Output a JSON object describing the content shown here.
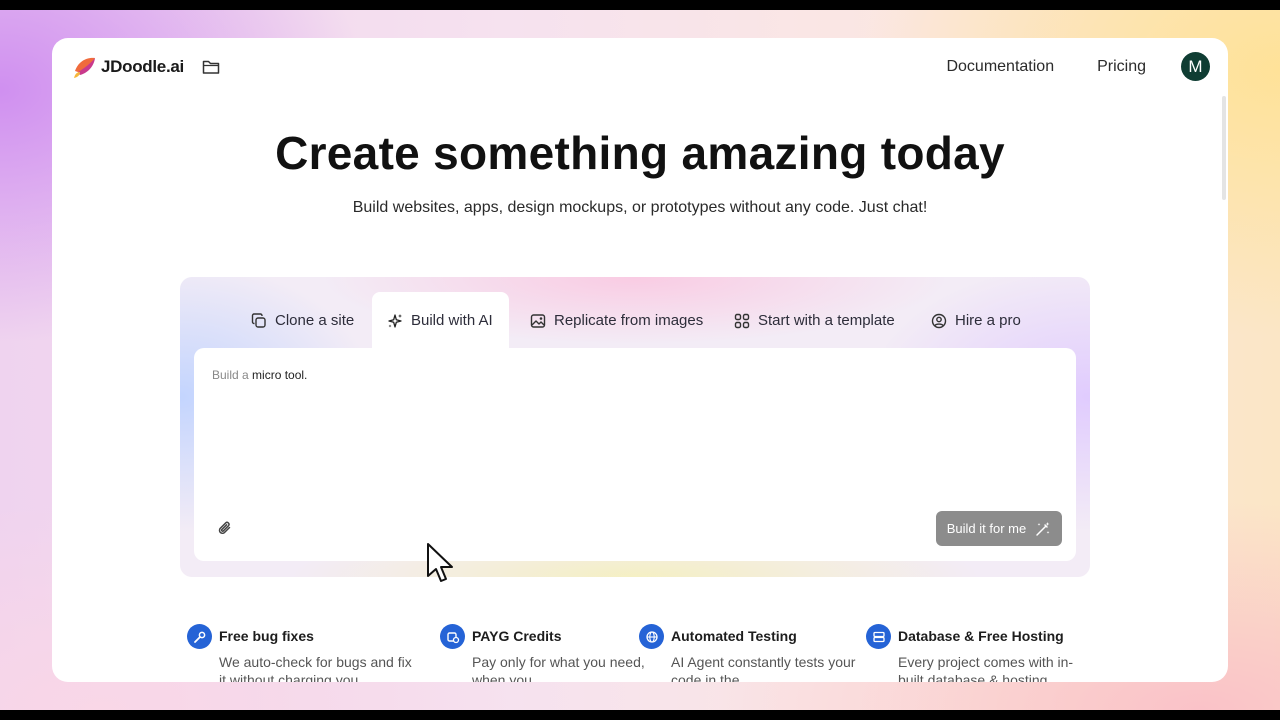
{
  "header": {
    "logo_text": "JDoodle.ai",
    "nav": [
      {
        "label": "Documentation"
      },
      {
        "label": "Pricing"
      }
    ],
    "avatar_initial": "M"
  },
  "hero": {
    "title": "Create something amazing today",
    "subtitle": "Build websites, apps, design mockups, or prototypes without any code. Just chat!"
  },
  "tabs": [
    {
      "label": "Clone a site",
      "icon": "copy-icon",
      "active": false
    },
    {
      "label": "Build with AI",
      "icon": "sparkles-icon",
      "active": true
    },
    {
      "label": "Replicate from images",
      "icon": "image-icon",
      "active": false
    },
    {
      "label": "Start with a template",
      "icon": "grid-icon",
      "active": false
    },
    {
      "label": "Hire a pro",
      "icon": "person-icon",
      "active": false
    }
  ],
  "editor": {
    "prompt_prefix": "Build a ",
    "prompt_emphasis": "micro tool.",
    "submit_label": "Build it for me"
  },
  "features": [
    {
      "title": "Free bug fixes",
      "desc": "We auto-check for bugs and fix it without charging you",
      "icon": "wrench-icon"
    },
    {
      "title": "PAYG Credits",
      "desc": "Pay only for what you need, when you",
      "icon": "credits-icon"
    },
    {
      "title": "Automated Testing",
      "desc": "AI Agent constantly tests your code in the",
      "icon": "globe-icon"
    },
    {
      "title": "Database & Free Hosting",
      "desc": "Every project comes with in-built database & hosting",
      "icon": "server-icon"
    }
  ],
  "colors": {
    "accent_blue": "#2563d6",
    "avatar_bg": "#0f3d33",
    "button_disabled": "#8c8c8c"
  }
}
